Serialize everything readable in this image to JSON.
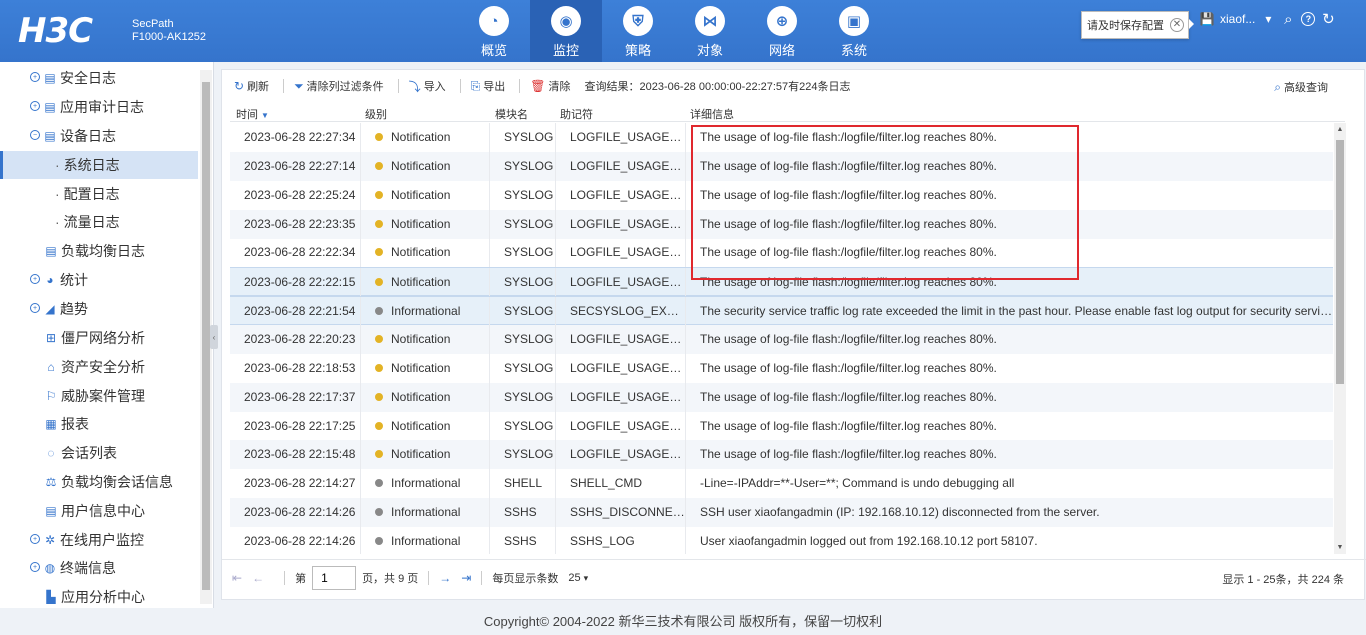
{
  "header": {
    "logo": "H3C",
    "model_line1": "SecPath",
    "model_line2": "F1000-AK1252",
    "nav": [
      {
        "label": "概览",
        "icon": "◔",
        "name": "overview"
      },
      {
        "label": "监控",
        "icon": "◉",
        "name": "monitor",
        "active": true
      },
      {
        "label": "策略",
        "icon": "⛨",
        "name": "policy"
      },
      {
        "label": "对象",
        "icon": "⋈",
        "name": "object"
      },
      {
        "label": "网络",
        "icon": "⊕",
        "name": "network"
      },
      {
        "label": "系统",
        "icon": "▣",
        "name": "system"
      }
    ],
    "tooltip": "请及时保存配置",
    "tooltip_close": "✕",
    "username": "xiaof...",
    "icons": {
      "save": "💾",
      "dropdown": "▾",
      "search": "⌕",
      "help": "?",
      "refresh": "↻"
    }
  },
  "sidebar": {
    "items": [
      {
        "label": "安全日志",
        "icon": "▤",
        "expander": "+",
        "name": "security-log"
      },
      {
        "label": "应用审计日志",
        "icon": "▤",
        "expander": "+",
        "name": "app-audit-log"
      },
      {
        "label": "设备日志",
        "icon": "▤",
        "expander": "−",
        "name": "device-log"
      },
      {
        "label": "系统日志",
        "sub": true,
        "active": true,
        "name": "system-log"
      },
      {
        "label": "配置日志",
        "sub": true,
        "name": "config-log"
      },
      {
        "label": "流量日志",
        "sub": true,
        "name": "traffic-log"
      },
      {
        "label": "负载均衡日志",
        "icon": "▤",
        "name": "lb-log"
      },
      {
        "label": "统计",
        "icon": "◕",
        "expander": "+",
        "name": "statistics"
      },
      {
        "label": "趋势",
        "icon": "◢",
        "expander": "+",
        "name": "trend"
      },
      {
        "label": "僵尸网络分析",
        "icon": "⊞",
        "name": "botnet-analysis"
      },
      {
        "label": "资产安全分析",
        "icon": "⌂",
        "name": "asset-analysis"
      },
      {
        "label": "威胁案件管理",
        "icon": "⚐",
        "name": "threat-case"
      },
      {
        "label": "报表",
        "icon": "▦",
        "name": "report"
      },
      {
        "label": "会话列表",
        "icon": "◌",
        "name": "session-list"
      },
      {
        "label": "负载均衡会话信息",
        "icon": "⚖",
        "name": "lb-session"
      },
      {
        "label": "用户信息中心",
        "icon": "▤",
        "name": "user-info"
      },
      {
        "label": "在线用户监控",
        "icon": "✲",
        "expander": "+",
        "name": "online-users"
      },
      {
        "label": "终端信息",
        "icon": "◍",
        "expander": "+",
        "name": "terminal-info"
      },
      {
        "label": "应用分析中心",
        "icon": "▙",
        "name": "app-analysis"
      }
    ]
  },
  "toolbar": {
    "refresh": "刷新",
    "clear_filter": "清除列过滤条件",
    "import": "导入",
    "export": "导出",
    "clear": "清除",
    "query_result": "查询结果：2023-06-28 00:00:00-22:27:57有224条日志",
    "advanced_query": "高级查询"
  },
  "grid": {
    "columns": {
      "time": "时间",
      "level": "级别",
      "module": "模块名",
      "mnemonic": "助记符",
      "detail": "详细信息"
    },
    "level_colors": {
      "Notification": "#e3b325",
      "Informational": "#888888"
    },
    "rows": [
      {
        "time": "2023-06-28 22:27:34",
        "level": "Notification",
        "module": "SYSLOG",
        "mnemonic": "LOGFILE_USAGEHI...",
        "detail": "The usage of log-file flash:/logfile/filter.log reaches 80%."
      },
      {
        "time": "2023-06-28 22:27:14",
        "level": "Notification",
        "module": "SYSLOG",
        "mnemonic": "LOGFILE_USAGEHI...",
        "detail": "The usage of log-file flash:/logfile/filter.log reaches 80%."
      },
      {
        "time": "2023-06-28 22:25:24",
        "level": "Notification",
        "module": "SYSLOG",
        "mnemonic": "LOGFILE_USAGEHI...",
        "detail": "The usage of log-file flash:/logfile/filter.log reaches 80%."
      },
      {
        "time": "2023-06-28 22:23:35",
        "level": "Notification",
        "module": "SYSLOG",
        "mnemonic": "LOGFILE_USAGEHI...",
        "detail": "The usage of log-file flash:/logfile/filter.log reaches 80%."
      },
      {
        "time": "2023-06-28 22:22:34",
        "level": "Notification",
        "module": "SYSLOG",
        "mnemonic": "LOGFILE_USAGEHI...",
        "detail": "The usage of log-file flash:/logfile/filter.log reaches 80%."
      },
      {
        "time": "2023-06-28 22:22:15",
        "level": "Notification",
        "module": "SYSLOG",
        "mnemonic": "LOGFILE_USAGEHI...",
        "detail": "The usage of log-file flash:/logfile/filter.log reaches 80%."
      },
      {
        "time": "2023-06-28 22:21:54",
        "level": "Informational",
        "module": "SYSLOG",
        "mnemonic": "SECSYSLOG_EXCEE...",
        "detail": "The security service traffic log rate exceeded the limit in the past hour. Please enable fast log output for security service ..."
      },
      {
        "time": "2023-06-28 22:20:23",
        "level": "Notification",
        "module": "SYSLOG",
        "mnemonic": "LOGFILE_USAGEHI...",
        "detail": "The usage of log-file flash:/logfile/filter.log reaches 80%."
      },
      {
        "time": "2023-06-28 22:18:53",
        "level": "Notification",
        "module": "SYSLOG",
        "mnemonic": "LOGFILE_USAGEHI...",
        "detail": "The usage of log-file flash:/logfile/filter.log reaches 80%."
      },
      {
        "time": "2023-06-28 22:17:37",
        "level": "Notification",
        "module": "SYSLOG",
        "mnemonic": "LOGFILE_USAGEHI...",
        "detail": "The usage of log-file flash:/logfile/filter.log reaches 80%."
      },
      {
        "time": "2023-06-28 22:17:25",
        "level": "Notification",
        "module": "SYSLOG",
        "mnemonic": "LOGFILE_USAGEHI...",
        "detail": "The usage of log-file flash:/logfile/filter.log reaches 80%."
      },
      {
        "time": "2023-06-28 22:15:48",
        "level": "Notification",
        "module": "SYSLOG",
        "mnemonic": "LOGFILE_USAGEHI...",
        "detail": "The usage of log-file flash:/logfile/filter.log reaches 80%."
      },
      {
        "time": "2023-06-28 22:14:27",
        "level": "Informational",
        "module": "SHELL",
        "mnemonic": "SHELL_CMD",
        "detail": "-Line=-IPAddr=**-User=**; Command is undo debugging all"
      },
      {
        "time": "2023-06-28 22:14:26",
        "level": "Informational",
        "module": "SSHS",
        "mnemonic": "SSHS_DISCONNECT",
        "detail": "SSH user xiaofangadmin (IP: 192.168.10.12) disconnected from the server."
      },
      {
        "time": "2023-06-28 22:14:26",
        "level": "Informational",
        "module": "SSHS",
        "mnemonic": "SSHS_LOG",
        "detail": "User xiaofangadmin logged out from 192.168.10.12 port 58107."
      }
    ]
  },
  "pager": {
    "page_label": "第",
    "page_value": "1",
    "page_total": "页，共 9 页",
    "per_page_label": "每页显示条数",
    "per_page_value": "25",
    "summary": "显示 1 - 25条，共 224 条"
  },
  "footer": {
    "copyright": "Copyright© 2004-2022 新华三技术有限公司 版权所有，保留一切权利"
  }
}
